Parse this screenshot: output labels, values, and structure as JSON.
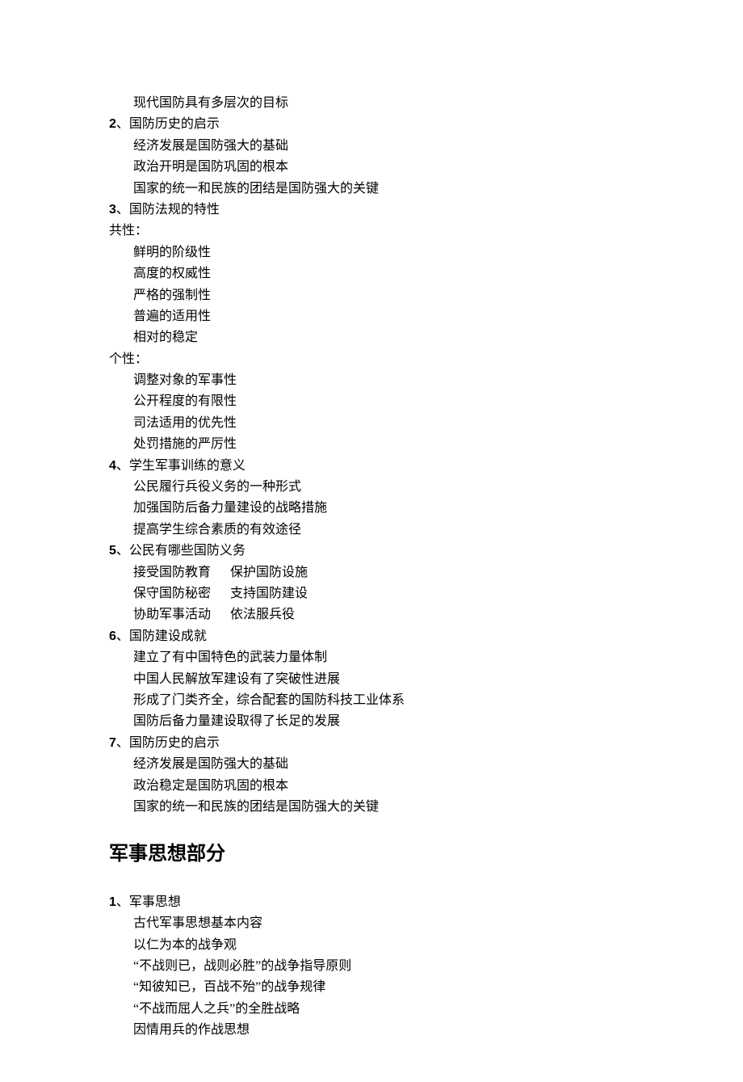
{
  "block0": {
    "line": "现代国防具有多层次的目标"
  },
  "section2": {
    "prefix": "2",
    "title": "、国防历史的启示",
    "items": [
      "经济发展是国防强大的基础",
      "政治开明是国防巩固的根本",
      "国家的统一和民族的团结是国防强大的关键"
    ]
  },
  "section3": {
    "prefix": "3",
    "title": "、国防法规的特性",
    "common_label": "共性：",
    "common_items": [
      "鲜明的阶级性",
      "高度的权威性",
      "严格的强制性",
      "普遍的适用性",
      "相对的稳定"
    ],
    "individual_label": "个性：",
    "individual_items": [
      "调整对象的军事性",
      "公开程度的有限性",
      "司法适用的优先性",
      "处罚措施的严厉性"
    ]
  },
  "section4": {
    "prefix": "4",
    "title": "、学生军事训练的意义",
    "items": [
      "公民履行兵役义务的一种形式",
      "加强国防后备力量建设的战略措施",
      "提高学生综合素质的有效途径"
    ]
  },
  "section5": {
    "prefix": "5",
    "title": "、公民有哪些国防义务",
    "pairs": [
      {
        "left": "接受国防教育",
        "right": "保护国防设施"
      },
      {
        "left": "保守国防秘密",
        "right": "支持国防建设"
      },
      {
        "left": "协助军事活动",
        "right": "依法服兵役"
      }
    ]
  },
  "section6": {
    "prefix": "6",
    "title": "、国防建设成就",
    "items": [
      "建立了有中国特色的武装力量体制",
      "中国人民解放军建设有了突破性进展",
      "形成了门类齐全，综合配套的国防科技工业体系",
      "国防后备力量建设取得了长足的发展"
    ]
  },
  "section7": {
    "prefix": "7",
    "title": "、国防历史的启示",
    "items": [
      "经济发展是国防强大的基础",
      "政治稳定是国防巩固的根本",
      "国家的统一和民族的团结是国防强大的关键"
    ]
  },
  "part2": {
    "heading": "军事思想部分"
  },
  "sectionB1": {
    "prefix": "1",
    "title": "、军事思想",
    "items": [
      "古代军事思想基本内容",
      "以仁为本的战争观",
      "“不战则已，战则必胜”的战争指导原则",
      "“知彼知已，百战不殆”的战争规律",
      "“不战而屈人之兵”的全胜战略",
      "因情用兵的作战思想"
    ]
  }
}
